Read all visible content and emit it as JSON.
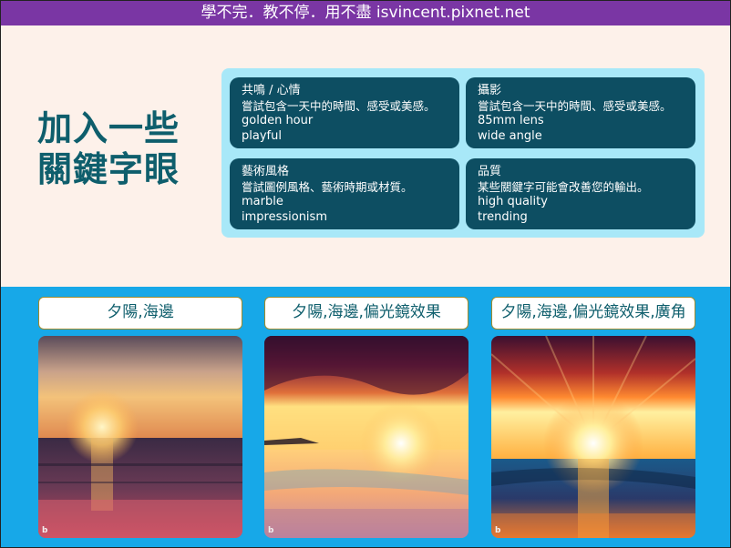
{
  "banner": {
    "text": "學不完．教不停．用不盡 isvincent.pixnet.net"
  },
  "headline": {
    "line1": "加入一些",
    "line2": "關鍵字眼"
  },
  "cards": [
    {
      "title": "共鳴 / 心情",
      "description": "嘗試包含一天中的時間、感受或美感。",
      "keywords": [
        "golden hour",
        "playful"
      ]
    },
    {
      "title": "攝影",
      "description": "嘗試包含一天中的時間、感受或美感。",
      "keywords": [
        "85mm lens",
        "wide angle"
      ]
    },
    {
      "title": "藝術風格",
      "description": "嘗試圖例風格、藝術時期或材質。",
      "keywords": [
        "marble",
        "impressionism"
      ]
    },
    {
      "title": "品質",
      "description": "某些關鍵字可能會改善您的輸出。",
      "keywords": [
        "high quality",
        "trending"
      ]
    }
  ],
  "examples": [
    {
      "caption": "夕陽,海邊",
      "image_icon": "bing-logo-icon",
      "bing_mark": "b"
    },
    {
      "caption": "夕陽,海邊,偏光鏡效果",
      "image_icon": "bing-logo-icon",
      "bing_mark": "b"
    },
    {
      "caption": "夕陽,海邊,偏光鏡效果,廣角",
      "image_icon": "bing-logo-icon",
      "bing_mark": "b"
    }
  ],
  "colors": {
    "banner": "#7a36a4",
    "headline": "#0e5e6c",
    "card_bg": "#0d4e62",
    "panel_bg": "#a8e8f8",
    "bottom_bg": "#17a8e8",
    "caption_border": "#a08a2a"
  }
}
